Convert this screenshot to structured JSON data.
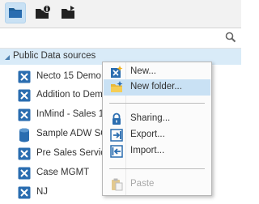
{
  "toolbar": {
    "buttons": [
      {
        "icon": "folder-icon",
        "active": true
      },
      {
        "icon": "folder-info-icon",
        "active": false
      },
      {
        "icon": "folder-share-icon",
        "active": false
      }
    ]
  },
  "search": {
    "icon": "search-icon",
    "value": ""
  },
  "tree": {
    "root": {
      "label": "Public Data sources",
      "expanded": true
    },
    "items": [
      {
        "label": "Necto 15 Demo",
        "icon": "cube-x-icon"
      },
      {
        "label": "Addition to Demo",
        "icon": "cube-x-icon"
      },
      {
        "label": "InMind - Sales 1",
        "icon": "cube-x-icon"
      },
      {
        "label": "Sample ADW SQL",
        "icon": "database-icon"
      },
      {
        "label": "Pre Sales Service",
        "icon": "cube-x-icon"
      },
      {
        "label": "Case MGMT",
        "icon": "cube-x-icon"
      },
      {
        "label": "NJ",
        "icon": "cube-x-icon"
      }
    ]
  },
  "context_menu": {
    "items": [
      {
        "label": "New...",
        "icon": "new-datasource-icon",
        "highlighted": false,
        "disabled": false
      },
      {
        "label": "New folder...",
        "icon": "new-folder-icon",
        "highlighted": true,
        "disabled": false
      },
      {
        "label": "Sharing...",
        "icon": "lock-icon",
        "highlighted": false,
        "disabled": false
      },
      {
        "label": "Export...",
        "icon": "export-icon",
        "highlighted": false,
        "disabled": false
      },
      {
        "label": "Import...",
        "icon": "import-icon",
        "highlighted": false,
        "disabled": false
      },
      {
        "label": "Paste",
        "icon": "paste-icon",
        "highlighted": false,
        "disabled": true
      }
    ]
  },
  "colors": {
    "accent": "#1f5f96",
    "selection": "#c9e1f4",
    "root_row": "#d9ebf8",
    "cube_blue": "#2a6db0",
    "disabled_text": "#a8a8a8"
  }
}
